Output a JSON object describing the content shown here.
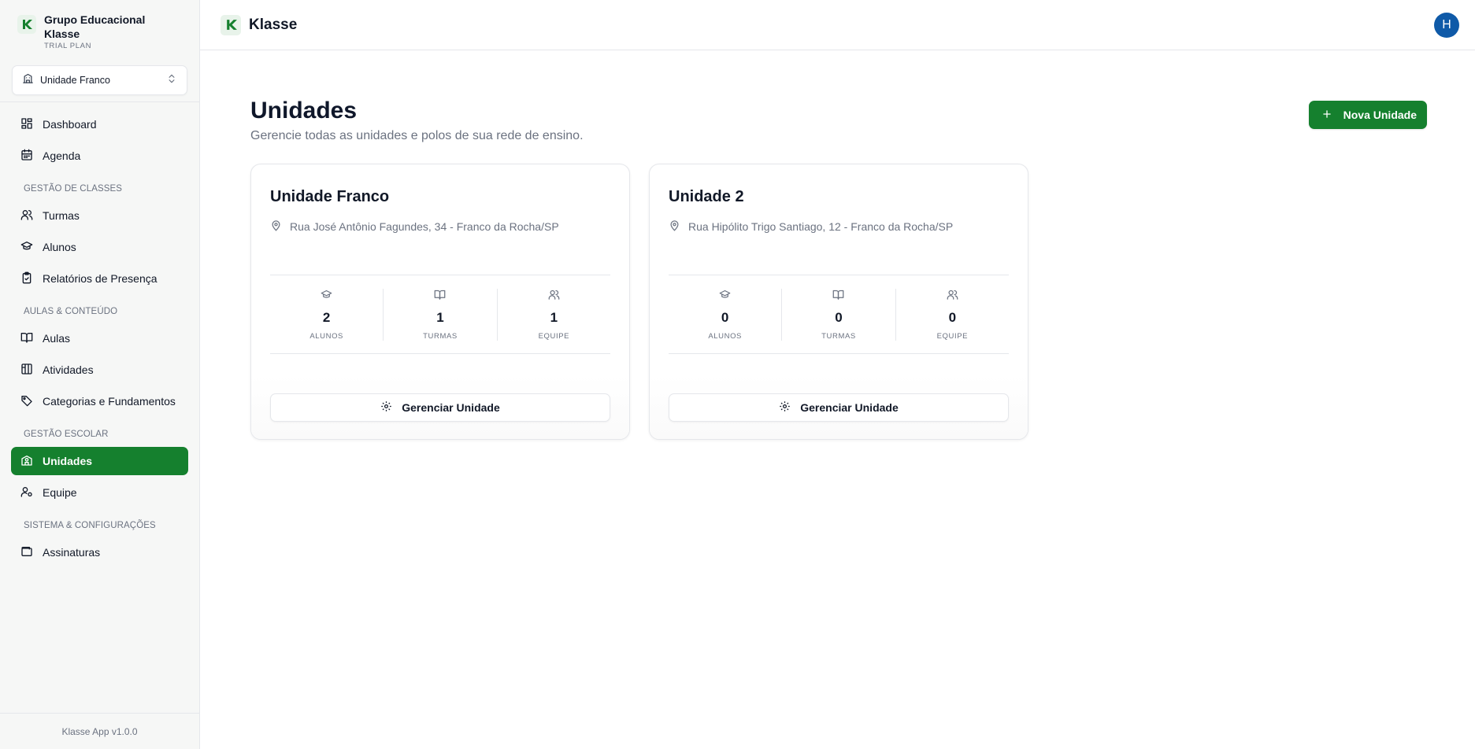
{
  "org": {
    "name": "Grupo Educacional Klasse",
    "plan": "TRIAL PLAN"
  },
  "unit_selector": {
    "value": "Unidade Franco"
  },
  "nav": {
    "dashboard": "Dashboard",
    "agenda": "Agenda",
    "section_classes": "GESTÃO DE CLASSES",
    "turmas": "Turmas",
    "alunos": "Alunos",
    "relatorios": "Relatórios de Presença",
    "section_aulas": "AULAS & CONTEÚDO",
    "aulas": "Aulas",
    "atividades": "Atividades",
    "categorias": "Categorias e Fundamentos",
    "section_escolar": "GESTÃO ESCOLAR",
    "unidades": "Unidades",
    "equipe": "Equipe",
    "section_sistema": "SISTEMA & CONFIGURAÇÕES",
    "assinaturas": "Assinaturas"
  },
  "footer": {
    "version": "Klasse App v1.0.0"
  },
  "topbar": {
    "brand": "Klasse",
    "avatar_initial": "H"
  },
  "page": {
    "title": "Unidades",
    "subtitle": "Gerencie todas as unidades e polos de sua rede de ensino.",
    "new_button": "Nova Unidade"
  },
  "cards": [
    {
      "name": "Unidade Franco",
      "address": "Rua José Antônio Fagundes, 34 - Franco da Rocha/SP",
      "stats": [
        {
          "value": "2",
          "label": "ALUNOS"
        },
        {
          "value": "1",
          "label": "TURMAS"
        },
        {
          "value": "1",
          "label": "EQUIPE"
        }
      ],
      "manage_label": "Gerenciar Unidade"
    },
    {
      "name": "Unidade 2",
      "address": "Rua Hipólito Trigo Santiago, 12 - Franco da Rocha/SP",
      "stats": [
        {
          "value": "0",
          "label": "ALUNOS"
        },
        {
          "value": "0",
          "label": "TURMAS"
        },
        {
          "value": "0",
          "label": "EQUIPE"
        }
      ],
      "manage_label": "Gerenciar Unidade"
    }
  ],
  "colors": {
    "accent": "#15802e",
    "avatar": "#0f5aa8",
    "muted": "#6b7280"
  },
  "icons": {
    "logo": "klasse-logo-icon",
    "unit_selector": "building-icon",
    "dashboard": "grid-icon",
    "agenda": "calendar-icon",
    "turmas": "users-icon",
    "alunos": "graduation-cap-icon",
    "relatorios": "clipboard-check-icon",
    "aulas": "book-open-icon",
    "atividades": "columns-icon",
    "categorias": "tag-icon",
    "unidades": "school-icon",
    "equipe": "user-cog-icon",
    "assinaturas": "wallet-icon",
    "address": "map-pin-icon",
    "manage": "gear-icon",
    "new": "plus-icon"
  }
}
